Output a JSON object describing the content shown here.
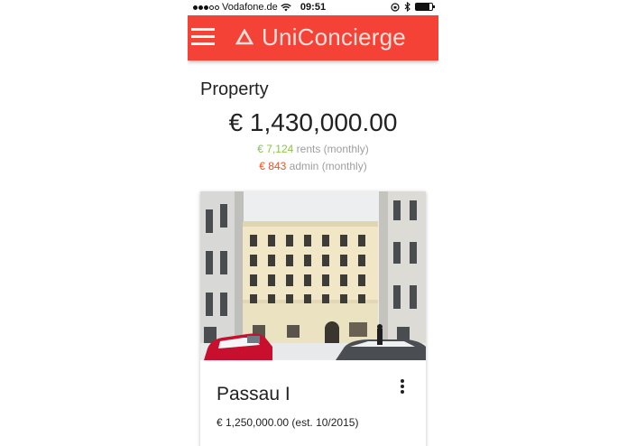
{
  "status_bar": {
    "carrier": "Vodafone.de",
    "time": "09:51",
    "icons": [
      "signal-dots-icon",
      "wifi-icon",
      "orientation-lock-icon",
      "bluetooth-icon",
      "battery-icon"
    ],
    "battery_level": 0.85
  },
  "app_bar": {
    "title": "UniConcierge",
    "menu_icon": "hamburger-menu-icon",
    "logo_icon": "triangle-logo-icon",
    "color": "#f44336"
  },
  "property": {
    "heading": "Property",
    "total_value": "€ 1,430,000.00",
    "rents_amount": "€ 7,124",
    "rents_label": "rents (monthly)",
    "admin_amount": "€ 843",
    "admin_label": "admin (monthly)",
    "rents_color": "#8bc34a",
    "admin_color": "#f4511e"
  },
  "card": {
    "title": "Passau I",
    "price": "€ 1,250,000.00 (est. 10/2015)",
    "more_icon": "more-vert-icon",
    "image": "building-photo"
  }
}
